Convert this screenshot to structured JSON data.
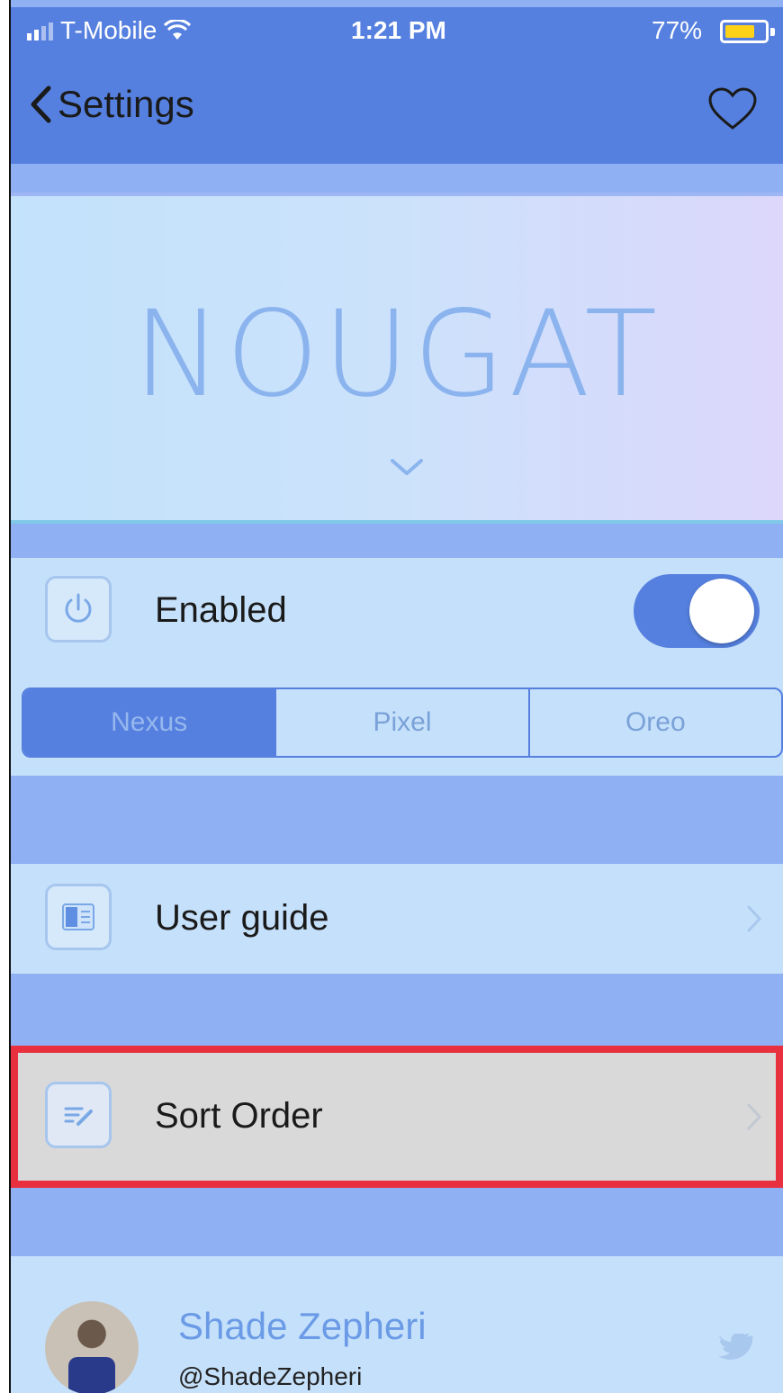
{
  "status_bar": {
    "carrier": "T-Mobile",
    "time": "1:21 PM",
    "battery_percent": "77%",
    "battery_level": 0.77
  },
  "nav": {
    "back_label": "Settings"
  },
  "banner": {
    "title": "NOUGAT"
  },
  "enabled": {
    "label": "Enabled",
    "is_on": true
  },
  "segments": {
    "options": [
      "Nexus",
      "Pixel",
      "Oreo"
    ],
    "selected": "Nexus"
  },
  "user_guide": {
    "label": "User guide"
  },
  "sort_order": {
    "label": "Sort Order"
  },
  "profile": {
    "name": "Shade Zepheri",
    "handle": "@ShadeZepheri"
  },
  "colors": {
    "accent": "#5680df",
    "highlight": "#e8303f",
    "row_bg": "#c5e0fa",
    "group_bg": "#8fb0f3"
  }
}
